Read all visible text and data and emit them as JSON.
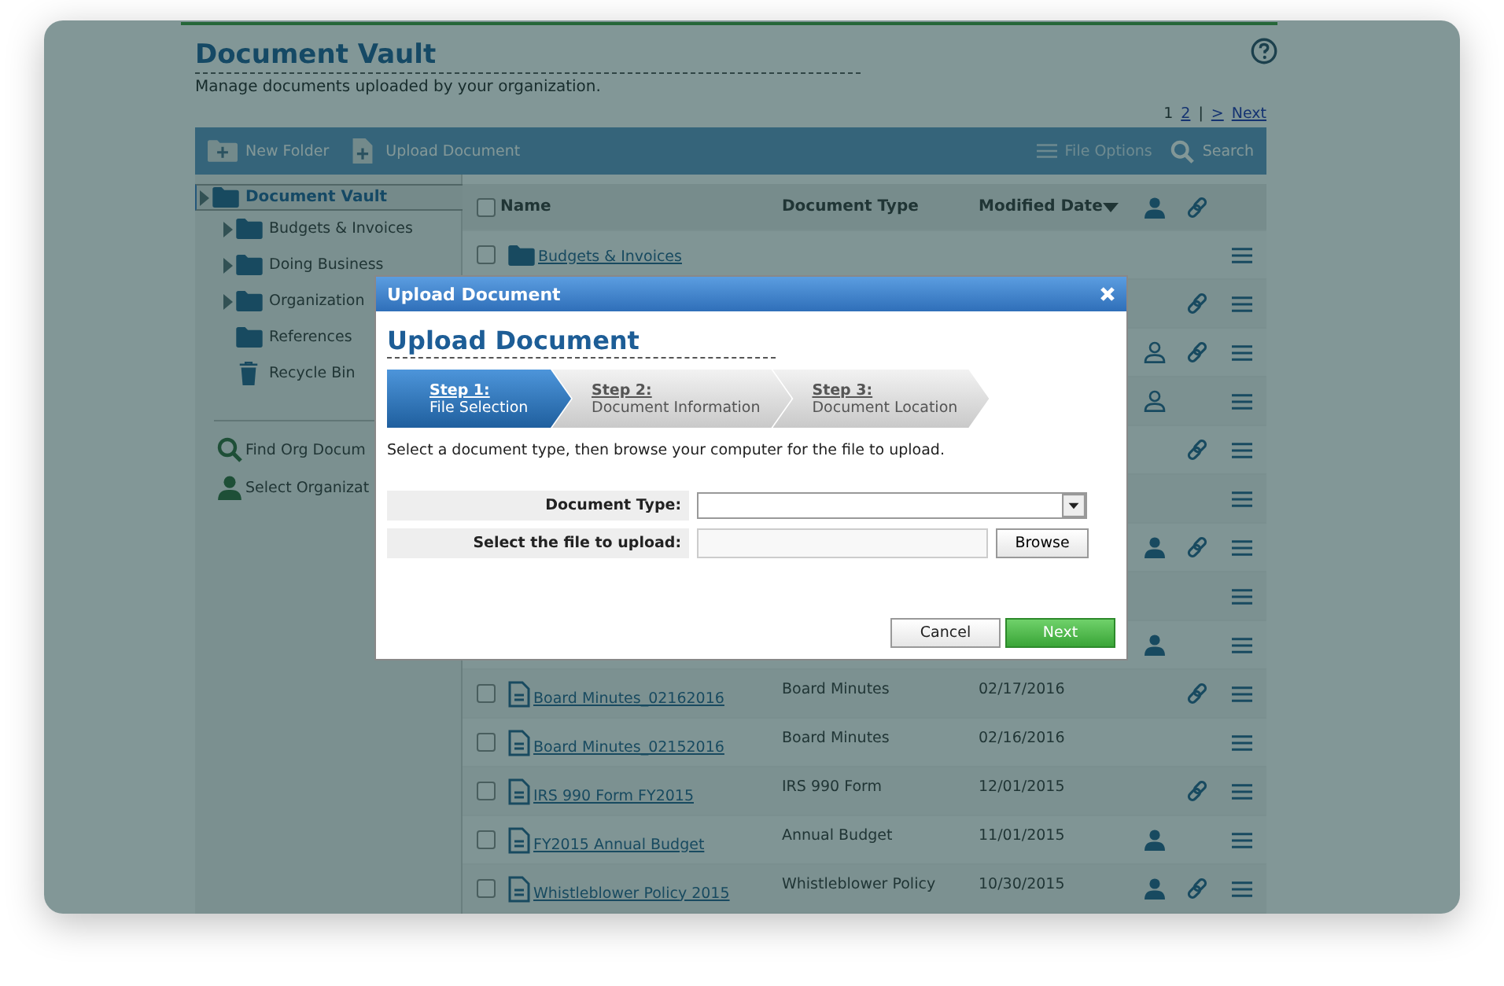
{
  "page": {
    "title": "Document Vault",
    "subtitle": "Manage documents uploaded by your organization."
  },
  "pagination": {
    "pages": [
      {
        "label": "1",
        "selected": true
      },
      {
        "label": "2",
        "selected": false
      }
    ],
    "separator": "|",
    "next_arrow": ">",
    "next": "Next"
  },
  "toolbar": {
    "left": [
      {
        "label": "New Folder",
        "kind": "folder"
      },
      {
        "label": "Upload Document",
        "kind": "document"
      }
    ],
    "right": [
      {
        "label": "File Options",
        "kind": "menu",
        "disabled": true
      },
      {
        "label": "Search",
        "kind": "search",
        "disabled": false
      }
    ]
  },
  "sidebar": {
    "items": [
      {
        "label": "Document Vault",
        "kind": "folder",
        "selected": true,
        "expandable": true,
        "nested": false
      },
      {
        "label": "Budgets & Invoices",
        "kind": "folder",
        "selected": false,
        "expandable": true,
        "nested": true
      },
      {
        "label": "Doing Business",
        "kind": "folder",
        "selected": false,
        "expandable": true,
        "nested": true
      },
      {
        "label": "Organization",
        "kind": "folder",
        "selected": false,
        "expandable": true,
        "nested": true
      },
      {
        "label": "References",
        "kind": "folder",
        "selected": false,
        "expandable": false,
        "nested": true
      },
      {
        "label": "Recycle Bin",
        "kind": "trash",
        "selected": false,
        "expandable": false,
        "nested": true
      }
    ],
    "links": [
      {
        "label": "Find Org Docum",
        "kind": "search"
      },
      {
        "label": "Select Organizat",
        "kind": "person"
      }
    ]
  },
  "table": {
    "columns": [
      {
        "label": "Name",
        "sorted": false
      },
      {
        "label": "Document Type",
        "sorted": false
      },
      {
        "label": "Modified Date",
        "sorted": true
      }
    ],
    "all_checked": false,
    "rows": [
      {
        "kind": "folder",
        "name": "Budgets & Invoices",
        "checked": false,
        "link": false
      },
      {
        "kind": "covered",
        "link": true
      },
      {
        "kind": "covered",
        "person": {
          "kind": "outline"
        },
        "link": true
      },
      {
        "kind": "covered",
        "person": {
          "kind": "outline"
        },
        "link": false
      },
      {
        "kind": "covered",
        "link": true
      },
      {
        "kind": "covered",
        "link": false
      },
      {
        "kind": "covered",
        "person": {
          "kind": "solid"
        },
        "link": true
      },
      {
        "kind": "covered",
        "link": false
      },
      {
        "kind": "covered",
        "person": {
          "kind": "solid"
        },
        "link": false
      },
      {
        "kind": "document",
        "name": "Board Minutes_02162016",
        "type": "Board Minutes",
        "date": "02/17/2016",
        "checked": false,
        "link": true
      },
      {
        "kind": "document",
        "name": "Board Minutes_02152016",
        "type": "Board Minutes",
        "date": "02/16/2016",
        "checked": false,
        "link": false
      },
      {
        "kind": "document",
        "name": "IRS 990 Form FY2015",
        "type": "IRS 990 Form",
        "date": "12/01/2015",
        "checked": false,
        "link": true
      },
      {
        "kind": "document",
        "name": "FY2015 Annual Budget",
        "type": "Annual Budget",
        "date": "11/01/2015",
        "checked": false,
        "person": {
          "kind": "solid"
        },
        "link": false
      },
      {
        "kind": "document",
        "name": "Whistleblower Policy 2015",
        "type": "Whistleblower Policy",
        "date": "10/30/2015",
        "checked": false,
        "person": {
          "kind": "solid"
        },
        "link": true
      }
    ]
  },
  "dialog": {
    "title": "Upload Document",
    "heading": "Upload Document",
    "steps": [
      {
        "step": "Step 1:",
        "label": "File Selection",
        "selected": true
      },
      {
        "step": "Step 2:",
        "label": "Document Information",
        "selected": false
      },
      {
        "step": "Step 3:",
        "label": "Document Location",
        "selected": false
      }
    ],
    "instruction": "Select a document type, then browse your computer for the file to upload.",
    "fields": [
      {
        "label": "Document Type:",
        "kind": "select"
      },
      {
        "label": "Select the file to upload:",
        "kind": "file",
        "button": "Browse"
      }
    ],
    "buttons": [
      {
        "label": "Cancel",
        "kind": "secondary"
      },
      {
        "label": "Next",
        "kind": "primary"
      }
    ]
  }
}
